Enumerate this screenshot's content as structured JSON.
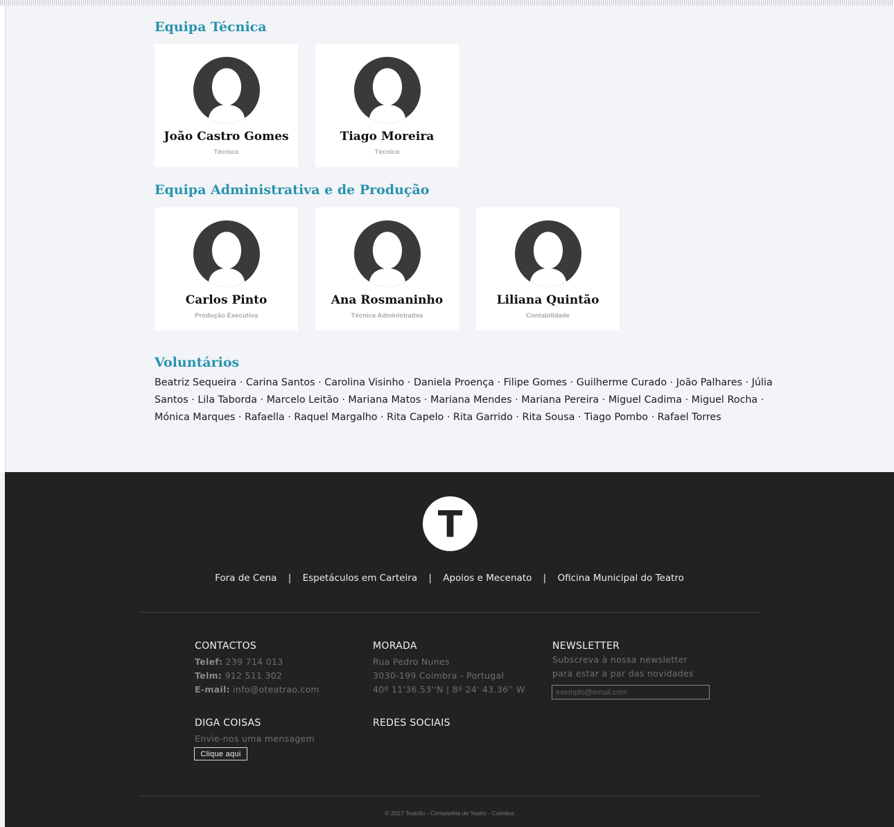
{
  "sections": {
    "tecnica": {
      "title": "Equipa Técnica",
      "members": [
        {
          "name": "João Castro Gomes",
          "role": "Técnico"
        },
        {
          "name": "Tiago Moreira",
          "role": "Técnico"
        }
      ]
    },
    "administrativa": {
      "title": "Equipa Administrativa e de Produção",
      "members": [
        {
          "name": "Carlos Pinto",
          "role": "Produção Executiva"
        },
        {
          "name": "Ana Rosmaninho",
          "role": "Técnica Administrativa"
        },
        {
          "name": "Liliana Quintão",
          "role": "Contabilidade"
        }
      ]
    },
    "voluntarios": {
      "title": "Voluntários",
      "text": "Beatriz Sequeira · Carina Santos · Carolina Visinho · Daniela Proença · Filipe Gomes · Guilherme Curado · João Palhares · Júlia Santos · Lila Taborda · Marcelo Leitão · Mariana Matos · Mariana Mendes · Mariana Pereira · Miguel Cadima · Miguel Rocha · Mónica Marques · Rafaella · Raquel Margalho · Rita Capelo · Rita Garrido · Rita Sousa · Tiago Pombo · Rafael Torres"
    }
  },
  "footer": {
    "logo_letter": "T",
    "nav": [
      "Fora de Cena",
      "Espetáculos em Carteira",
      "Apoios e Mecenato",
      "Oficina Municipal do Teatro"
    ],
    "nav_separator": "|",
    "contactos": {
      "title": "CONTACTOS",
      "telef_label": "Telef:",
      "telef": "239 714 013",
      "telm_label": "Telm:",
      "telm": "912 511 302",
      "email_label": "E-mail:",
      "email": "info@oteatrao.com"
    },
    "morada": {
      "title": "MORADA",
      "lines": [
        "Rua Pedro Nunes",
        "3030-199 Coimbra - Portugal",
        "40º 11'36.53''N | 8º 24' 43.36'' W"
      ]
    },
    "newsletter": {
      "title": "NEWSLETTER",
      "lines": [
        "Subscreva à nossa newsletter",
        "para estar a par das novidades"
      ],
      "placeholder": "exemplo@email.com"
    },
    "diga": {
      "title": "DIGA COISAS",
      "text": "Envie-nos uma mensagem",
      "button": "Clique aqui"
    },
    "redes": {
      "title": "REDES SOCIAIS"
    },
    "copyright": "© 2017 Teatrão - Companhia de Teatro - Coimbra"
  },
  "colors": {
    "accent": "#2a93ae",
    "page_bg": "#f2f4f7",
    "footer_bg": "#222222"
  }
}
